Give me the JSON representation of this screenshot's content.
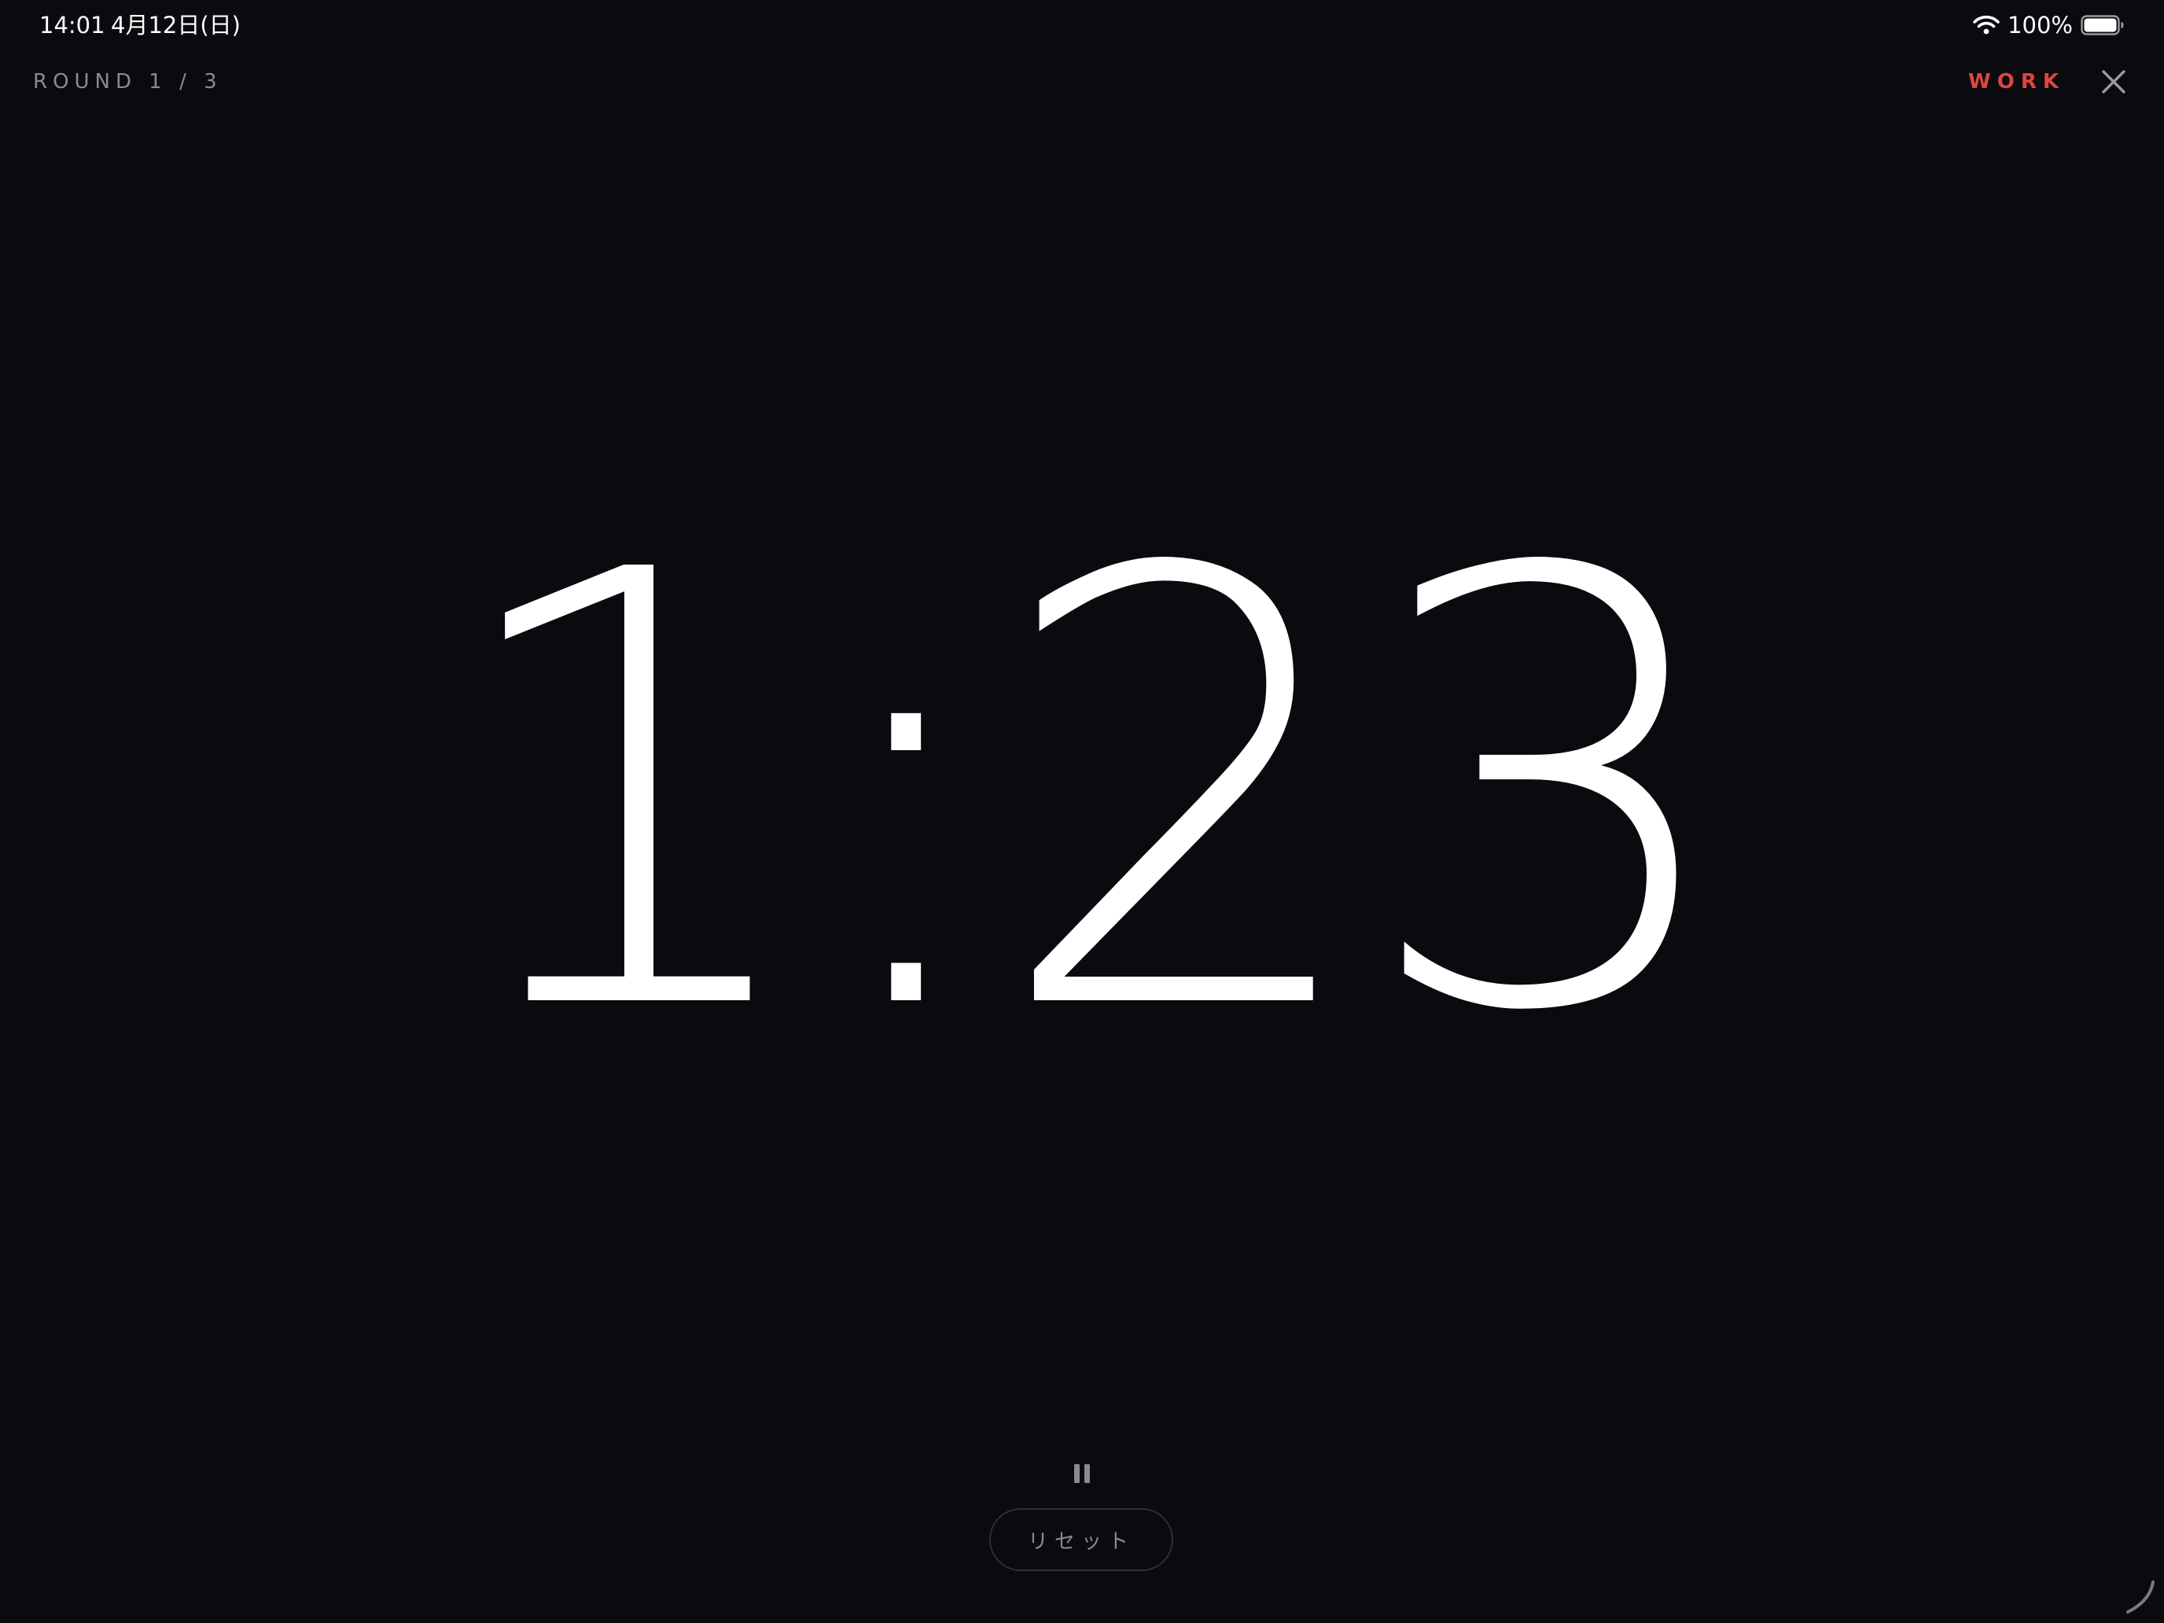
{
  "status_bar": {
    "time": "14:01",
    "date": "4月12日(日)",
    "battery": "100%",
    "wifi_icon": "wifi-icon",
    "battery_icon": "battery-full-icon"
  },
  "header": {
    "round": "ROUND 1 / 3",
    "phase": "WORK",
    "close_icon": "close-icon"
  },
  "timer": {
    "display": "1:23"
  },
  "controls": {
    "pause_icon": "pause-icon",
    "reset_label": "リセット"
  },
  "colors": {
    "background": "#0a0a0f",
    "phase_accent": "#e0443f",
    "muted_text": "#8a8a90",
    "timer_text": "#ffffff"
  }
}
